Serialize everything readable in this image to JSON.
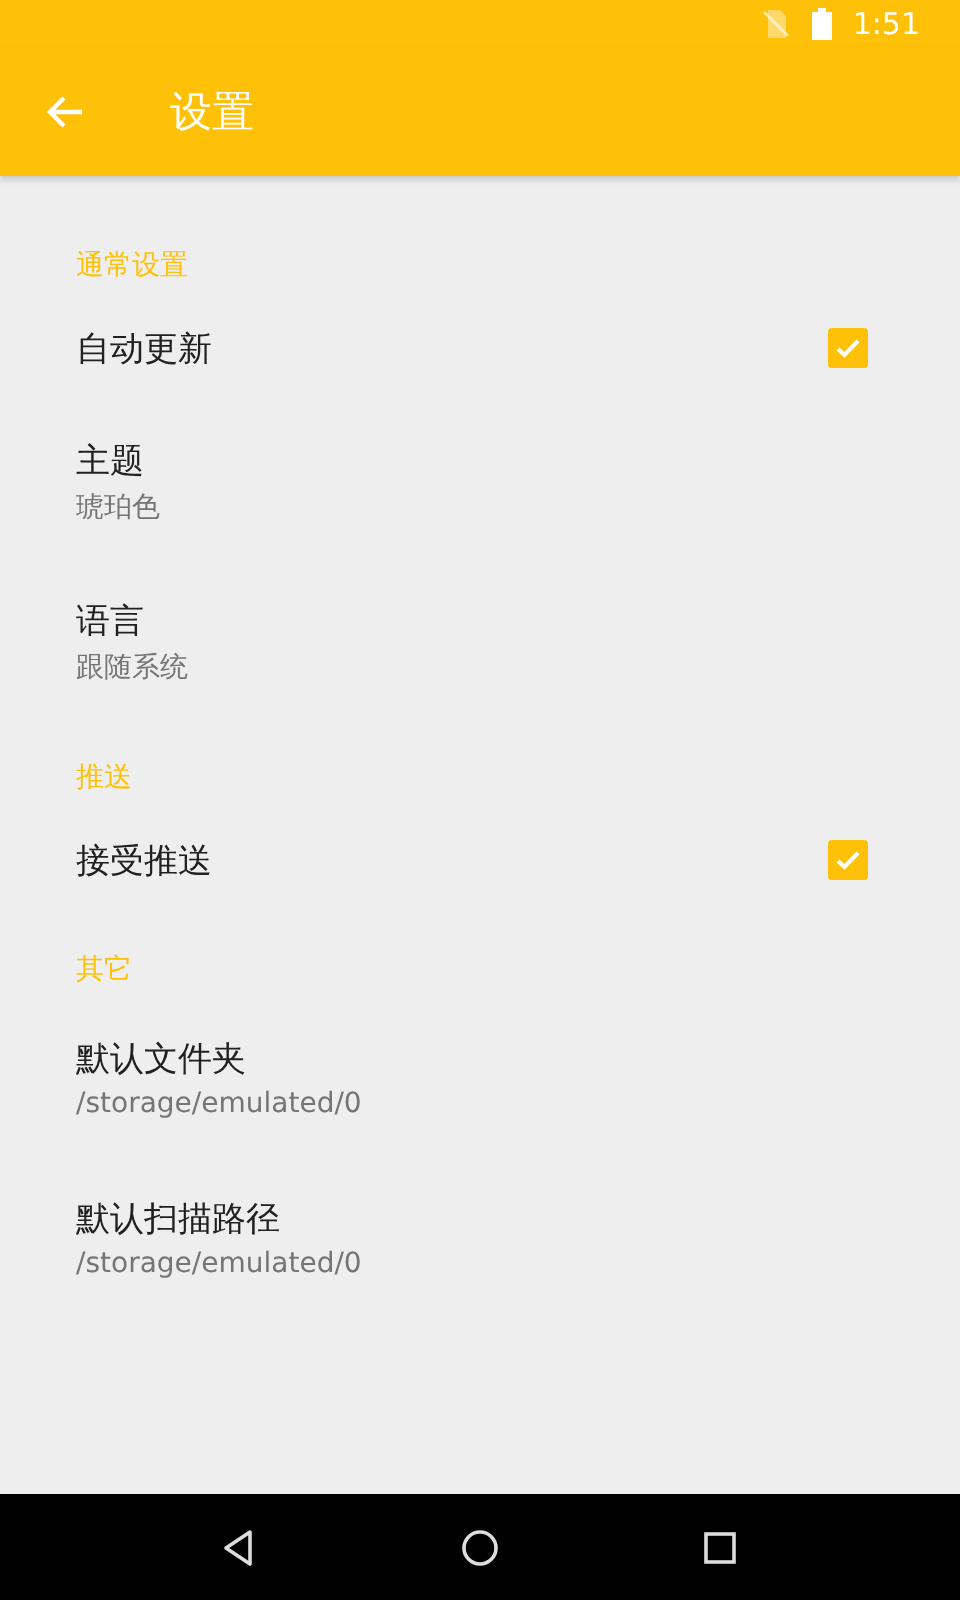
{
  "status_bar": {
    "time": "1:51"
  },
  "toolbar": {
    "title": "设置"
  },
  "sections": [
    {
      "title": "通常设置",
      "items": [
        {
          "kind": "checkbox",
          "title": "自动更新",
          "checked": true
        },
        {
          "kind": "text",
          "title": "主题",
          "summary": "琥珀色"
        },
        {
          "kind": "text",
          "title": "语言",
          "summary": "跟随系统"
        }
      ]
    },
    {
      "title": "推送",
      "items": [
        {
          "kind": "checkbox",
          "title": "接受推送",
          "checked": true
        }
      ]
    },
    {
      "title": "其它",
      "items": [
        {
          "kind": "text",
          "title": "默认文件夹",
          "summary": "/storage/emulated/0"
        },
        {
          "kind": "text",
          "title": "默认扫描路径",
          "summary": "/storage/emulated/0"
        }
      ]
    }
  ]
}
